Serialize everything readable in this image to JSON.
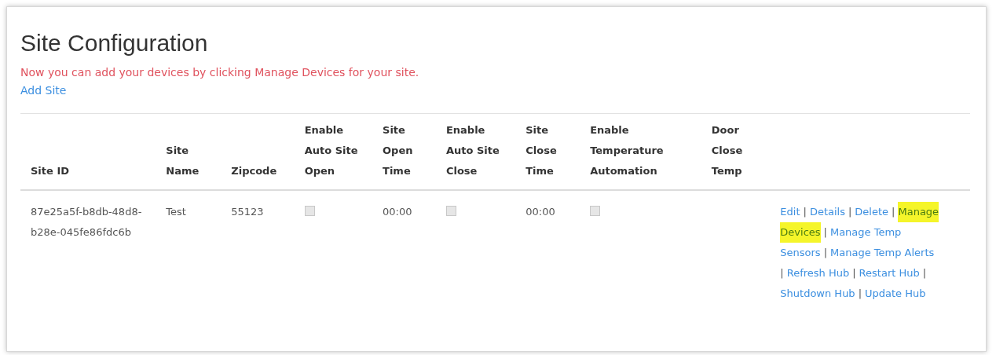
{
  "page": {
    "title": "Site Configuration",
    "notice": "Now you can add your devices by clicking Manage Devices for your site.",
    "add_link": "Add Site"
  },
  "table": {
    "columns": [
      "Site ID",
      "Site Name",
      "Zipcode",
      "Enable Auto Site Open",
      "Site Open Time",
      "Enable Auto Site Close",
      "Site Close Time",
      "Enable Temperature Automation",
      "Door Close Temp"
    ],
    "rows": [
      {
        "cells": [
          {
            "kind": "text",
            "text": "87e25a5f-b8db-48d8-b28e-045fe86fdc6b"
          },
          {
            "kind": "text",
            "text": "Test"
          },
          {
            "kind": "text",
            "text": "55123"
          },
          {
            "kind": "checkbox",
            "checked": false,
            "disabled": true
          },
          {
            "kind": "text",
            "text": "00:00"
          },
          {
            "kind": "checkbox",
            "checked": false,
            "disabled": true
          },
          {
            "kind": "text",
            "text": "00:00"
          },
          {
            "kind": "checkbox",
            "checked": false,
            "disabled": true
          }
        ],
        "action_lines": [
          [
            {
              "kind": "link",
              "label": "Edit",
              "highlighted": false
            },
            {
              "kind": "separator",
              "label": "|"
            },
            {
              "kind": "link",
              "label": "Details",
              "highlighted": false
            },
            {
              "kind": "separator",
              "label": "|"
            },
            {
              "kind": "link",
              "label": "Delete",
              "highlighted": false
            },
            {
              "kind": "separator",
              "label": "|"
            },
            {
              "kind": "link",
              "label": "Manage",
              "highlighted": true
            }
          ],
          [
            {
              "kind": "link",
              "label": "Devices",
              "highlighted": true
            },
            {
              "kind": "separator",
              "label": "|"
            },
            {
              "kind": "link",
              "label": "Manage Temp",
              "highlighted": false
            }
          ],
          [
            {
              "kind": "link",
              "label": "Sensors",
              "highlighted": false
            },
            {
              "kind": "separator",
              "label": "|"
            },
            {
              "kind": "link",
              "label": "Manage Temp Alerts",
              "highlighted": false
            }
          ],
          [
            {
              "kind": "separator",
              "label": "|"
            },
            {
              "kind": "link",
              "label": "Refresh Hub",
              "highlighted": false
            },
            {
              "kind": "separator",
              "label": "|"
            },
            {
              "kind": "link",
              "label": "Restart Hub",
              "highlighted": false
            },
            {
              "kind": "separator",
              "label": "|"
            }
          ],
          [
            {
              "kind": "link",
              "label": "Shutdown Hub",
              "highlighted": false
            },
            {
              "kind": "separator",
              "label": "|"
            },
            {
              "kind": "link",
              "label": "Update Hub",
              "highlighted": false
            }
          ]
        ]
      }
    ]
  }
}
